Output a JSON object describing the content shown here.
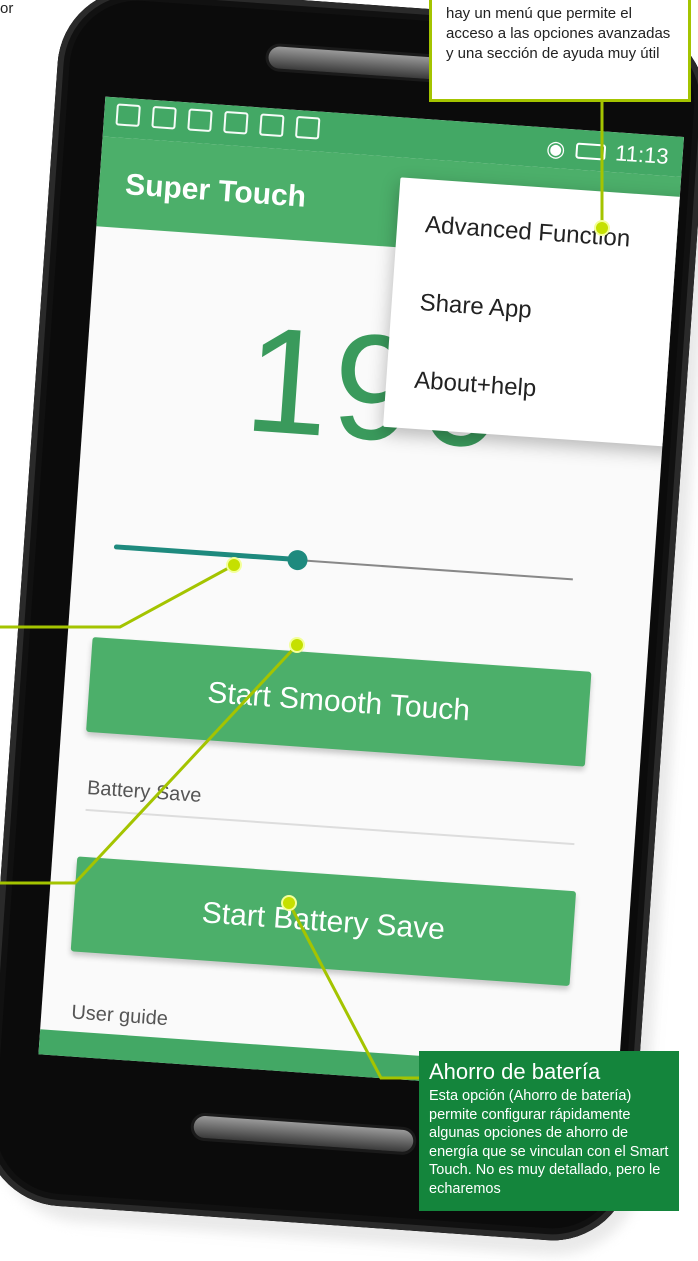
{
  "colors": {
    "primary": "#4caf6a",
    "statusbar": "#43a865",
    "accent": "#1e8a7e",
    "callout_green": "#14853c",
    "leader": "#a4c400"
  },
  "edge_text": "or",
  "status_bar": {
    "time": "11:13",
    "icons": [
      "image-icon",
      "gmail-icon",
      "gmail-icon",
      "cookie-icon",
      "message-icon",
      "clipboard-icon",
      "nfc-icon",
      "vibrate-icon",
      "alarm-icon",
      "wifi-icon",
      "signal-icon",
      "battery-icon"
    ]
  },
  "app": {
    "title": "Super Touch",
    "counter": "190",
    "slider": {
      "value": 0.4
    },
    "smooth_button": "Start Smooth Touch",
    "battery_label": "Battery Save",
    "battery_button": "Start Battery Save",
    "user_guide": "User guide"
  },
  "menu": {
    "items": [
      "Advanced Function",
      "Share App",
      "About+help"
    ]
  },
  "callout_top": {
    "text": "hay un menú que permite el acceso a las opciones avanzadas y una sección de ayuda muy útil"
  },
  "callout_bottom": {
    "title": "Ahorro de batería",
    "body": "Esta opción (Ahorro de batería) permite configurar rápidamente algunas opciones de ahorro de energía que se vinculan con el Smart Touch. No es muy detallado, pero le echaremos"
  },
  "nav": {
    "icons": [
      "back-icon",
      "home-icon"
    ]
  }
}
